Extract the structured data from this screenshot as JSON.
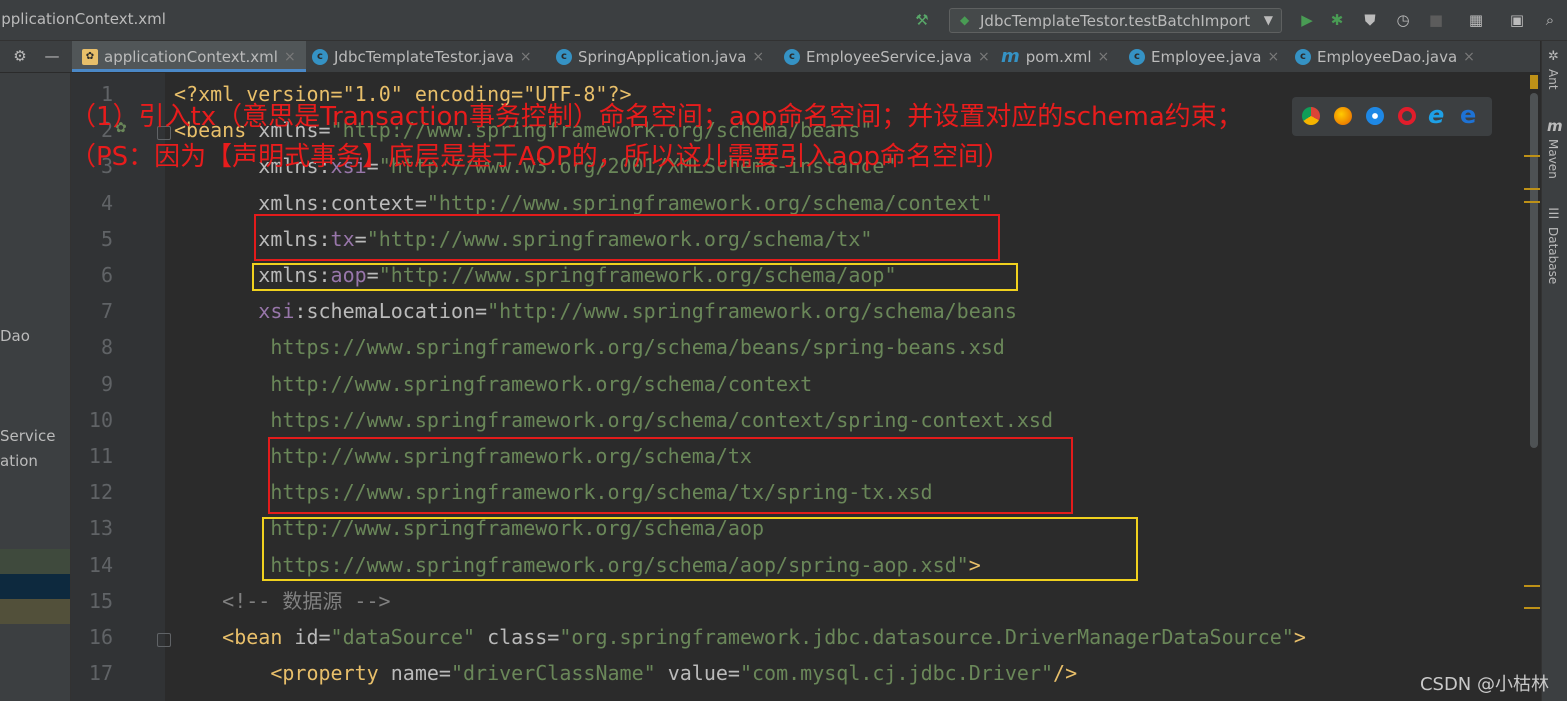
{
  "window": {
    "title": "applicationContext.xml",
    "run_config": "JdbcTemplateTestor.testBatchImport"
  },
  "tabs": [
    {
      "label": "applicationContext.xml",
      "icon": "xml-spring-icon",
      "active": true
    },
    {
      "label": "JdbcTemplateTestor.java",
      "icon": "java-class-icon",
      "active": false
    },
    {
      "label": "SpringApplication.java",
      "icon": "java-class-icon",
      "active": false
    },
    {
      "label": "EmployeeService.java",
      "icon": "java-class-icon",
      "active": false
    },
    {
      "label": "pom.xml",
      "icon": "maven-icon",
      "active": false
    },
    {
      "label": "Employee.java",
      "icon": "java-class-icon",
      "active": false
    },
    {
      "label": "EmployeeDao.java",
      "icon": "java-class-icon",
      "active": false
    }
  ],
  "project_pane": {
    "items": [
      "Dao",
      "Service",
      "ation"
    ]
  },
  "right_tools": [
    "Ant",
    "Maven",
    "Database"
  ],
  "editor": {
    "line_numbers": [
      "1",
      "2",
      "3",
      "4",
      "5",
      "6",
      "7",
      "8",
      "9",
      "10",
      "11",
      "12",
      "13",
      "14",
      "15",
      "16",
      "17"
    ],
    "lines": [
      [
        {
          "cls": "p",
          "text": "<?xml version=\"1.0\" encoding=\"UTF-8\"?>"
        }
      ],
      [
        {
          "cls": "t",
          "text": "<beans "
        },
        {
          "cls": "a",
          "text": "xmlns="
        },
        {
          "cls": "v",
          "text": "\"http://www.springframework.org/schema/beans\""
        }
      ],
      [
        {
          "cls": "a",
          "text": "       xmlns:"
        },
        {
          "cls": "ns",
          "text": "xsi"
        },
        {
          "cls": "a",
          "text": "="
        },
        {
          "cls": "v",
          "text": "\"http://www.w3.org/2001/XMLSchema-instance\""
        }
      ],
      [
        {
          "cls": "a",
          "text": "       xmlns:context="
        },
        {
          "cls": "v",
          "text": "\"http://www.springframework.org/schema/context\""
        }
      ],
      [
        {
          "cls": "a",
          "text": "       xmlns:"
        },
        {
          "cls": "ns",
          "text": "tx"
        },
        {
          "cls": "a",
          "text": "="
        },
        {
          "cls": "v",
          "text": "\"http://www.springframework.org/schema/tx\""
        }
      ],
      [
        {
          "cls": "a",
          "text": "       xmlns:"
        },
        {
          "cls": "ns",
          "text": "aop"
        },
        {
          "cls": "a",
          "text": "="
        },
        {
          "cls": "v",
          "text": "\"http://www.springframework.org/schema/aop\""
        }
      ],
      [
        {
          "cls": "ns",
          "text": "       xsi"
        },
        {
          "cls": "a",
          "text": ":schemaLocation="
        },
        {
          "cls": "v",
          "text": "\"http://www.springframework.org/schema/beans"
        }
      ],
      [
        {
          "cls": "v",
          "text": "        https://www.springframework.org/schema/beans/spring-beans.xsd"
        }
      ],
      [
        {
          "cls": "v",
          "text": "        http://www.springframework.org/schema/context"
        }
      ],
      [
        {
          "cls": "v",
          "text": "        https://www.springframework.org/schema/context/spring-context.xsd"
        }
      ],
      [
        {
          "cls": "v",
          "text": "        http://www.springframework.org/schema/tx"
        }
      ],
      [
        {
          "cls": "v",
          "text": "        https://www.springframework.org/schema/tx/spring-tx.xsd"
        }
      ],
      [
        {
          "cls": "v",
          "text": "        http://www.springframework.org/schema/aop"
        }
      ],
      [
        {
          "cls": "v",
          "text": "        https://www.springframework.org/schema/aop/spring-aop.xsd\""
        },
        {
          "cls": "t",
          "text": ">"
        }
      ],
      [
        {
          "cls": "c",
          "text": "    <!-- 数据源 -->"
        }
      ],
      [
        {
          "cls": "t",
          "text": "    <bean "
        },
        {
          "cls": "a",
          "text": "id="
        },
        {
          "cls": "v",
          "text": "\"dataSource\" "
        },
        {
          "cls": "a",
          "text": "class="
        },
        {
          "cls": "v",
          "text": "\"org.springframework.jdbc.datasource.DriverManagerDataSource\""
        },
        {
          "cls": "t",
          "text": ">"
        }
      ],
      [
        {
          "cls": "t",
          "text": "        <property "
        },
        {
          "cls": "a",
          "text": "name="
        },
        {
          "cls": "v",
          "text": "\"driverClassName\" "
        },
        {
          "cls": "a",
          "text": "value="
        },
        {
          "cls": "v",
          "text": "\"com.mysql.cj.jdbc.Driver\""
        },
        {
          "cls": "t",
          "text": "/>"
        }
      ]
    ]
  },
  "annotations": {
    "line1": "（1）引入tx（意思是Transaction事务控制）命名空间；aop命名空间；并设置对应的schema约束；",
    "line2": "（PS：因为【声明式事务】底层是基于AOP的，所以这儿需要引入aop命名空间）"
  },
  "watermark": "CSDN @小枯林",
  "colors": {
    "red_box": "#e31b1b",
    "yellow_box": "#f0d11e",
    "annotation_text": "#e81c1c",
    "active_tab_underline": "#4a88c7"
  }
}
